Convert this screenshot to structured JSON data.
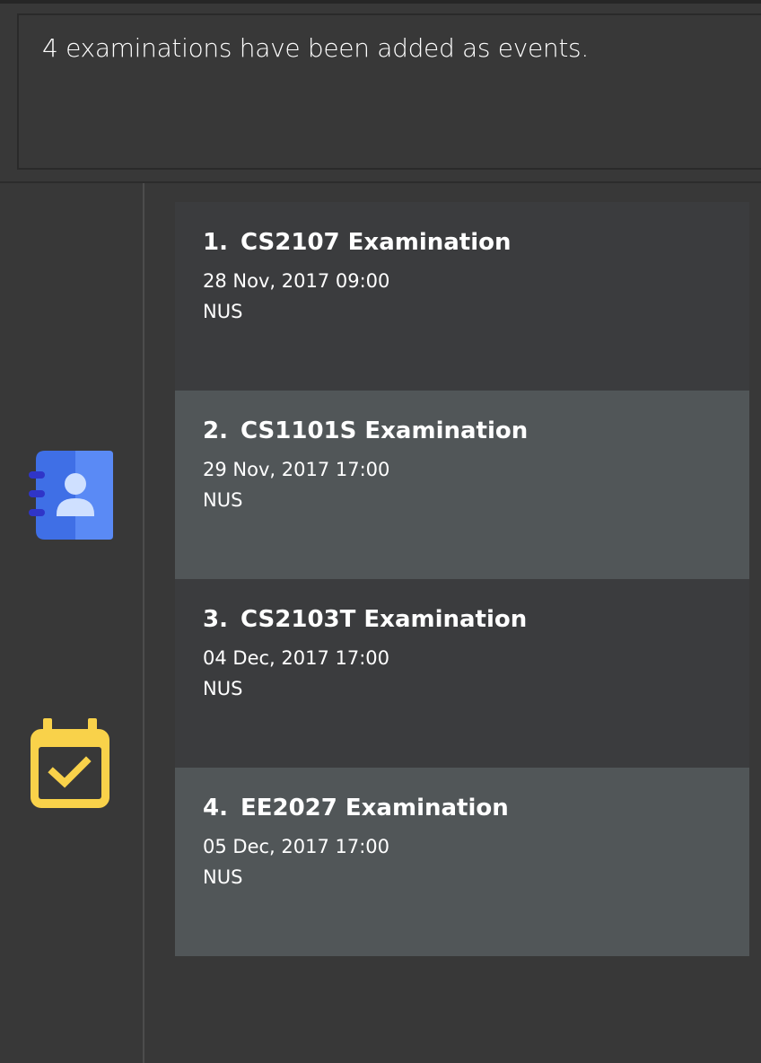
{
  "result_display": {
    "message": "4 examinations have been added as events."
  },
  "sidebar": {
    "items": [
      {
        "icon": "address-book-icon",
        "color": "#4a7cf0"
      },
      {
        "icon": "calendar-check-icon",
        "color": "#f9d24a"
      }
    ]
  },
  "events": [
    {
      "index": "1.",
      "title": "CS2107 Examination",
      "datetime": "28 Nov, 2017 09:00",
      "venue": "NUS"
    },
    {
      "index": "2.",
      "title": "CS1101S Examination",
      "datetime": "29 Nov, 2017 17:00",
      "venue": "NUS"
    },
    {
      "index": "3.",
      "title": "CS2103T Examination",
      "datetime": "04 Dec, 2017 17:00",
      "venue": "NUS"
    },
    {
      "index": "4.",
      "title": "EE2027 Examination",
      "datetime": "05 Dec, 2017 17:00",
      "venue": "NUS"
    }
  ],
  "colors": {
    "background": "#383838",
    "card_odd": "#3b3c3e",
    "card_even": "#515658",
    "text": "#ffffff"
  }
}
